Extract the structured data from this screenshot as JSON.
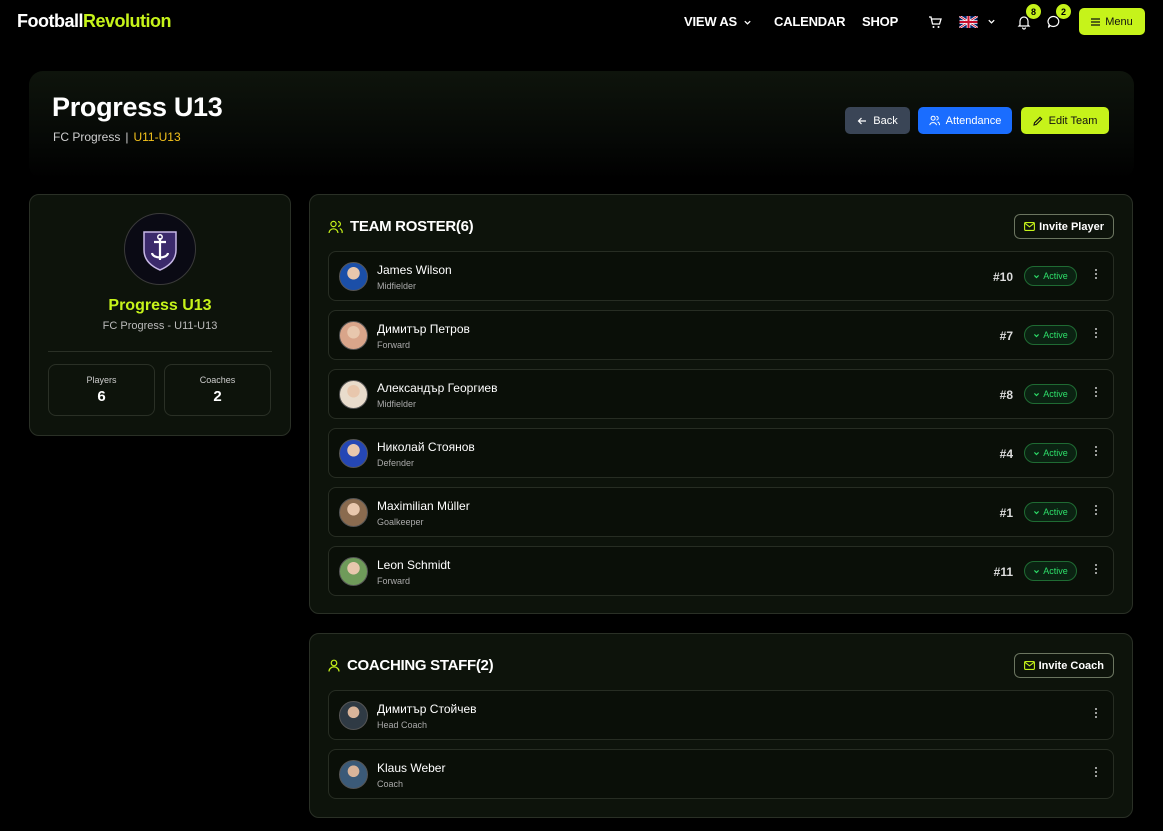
{
  "nav": {
    "logo_part1": "Football",
    "logo_part2": "Revolution",
    "view_as": "VIEW AS",
    "calendar": "CALENDAR",
    "shop": "SHOP",
    "notifications_count": "8",
    "messages_count": "2",
    "menu_label": "Menu"
  },
  "header": {
    "title": "Progress U13",
    "club": "FC Progress",
    "separator": "|",
    "age_group": "U11-U13",
    "back_label": "Back",
    "attendance_label": "Attendance",
    "edit_label": "Edit Team"
  },
  "team_card": {
    "name": "Progress U13",
    "subtitle": "FC Progress - U11-U13",
    "players_label": "Players",
    "players_value": "6",
    "coaches_label": "Coaches",
    "coaches_value": "2"
  },
  "roster": {
    "title": "TEAM ROSTER(6)",
    "invite_label": "Invite Player",
    "players": [
      {
        "name": "James Wilson",
        "position": "Midfielder",
        "number": "#10",
        "status": "Active",
        "color": "#1b4fa8"
      },
      {
        "name": "Димитър Петров",
        "position": "Forward",
        "number": "#7",
        "status": "Active",
        "color": "#d9a58a"
      },
      {
        "name": "Александър Георгиев",
        "position": "Midfielder",
        "number": "#8",
        "status": "Active",
        "color": "#e9dccc"
      },
      {
        "name": "Николай Стоянов",
        "position": "Defender",
        "number": "#4",
        "status": "Active",
        "color": "#2547b5"
      },
      {
        "name": "Maximilian Müller",
        "position": "Goalkeeper",
        "number": "#1",
        "status": "Active",
        "color": "#8a6b4f"
      },
      {
        "name": "Leon Schmidt",
        "position": "Forward",
        "number": "#11",
        "status": "Active",
        "color": "#6f9b5a"
      }
    ]
  },
  "coaching": {
    "title": "COACHING STAFF(2)",
    "invite_label": "Invite Coach",
    "coaches": [
      {
        "name": "Димитър Стойчев",
        "role": "Head Coach",
        "color": "#2f3a44"
      },
      {
        "name": "Klaus Weber",
        "role": "Coach",
        "color": "#3b5a78"
      }
    ]
  },
  "colors": {
    "accent": "#c6f31a",
    "status_active": "#2ee06a",
    "attendance_blue": "#1a6dff",
    "age_group_yellow": "#f4c21c"
  }
}
